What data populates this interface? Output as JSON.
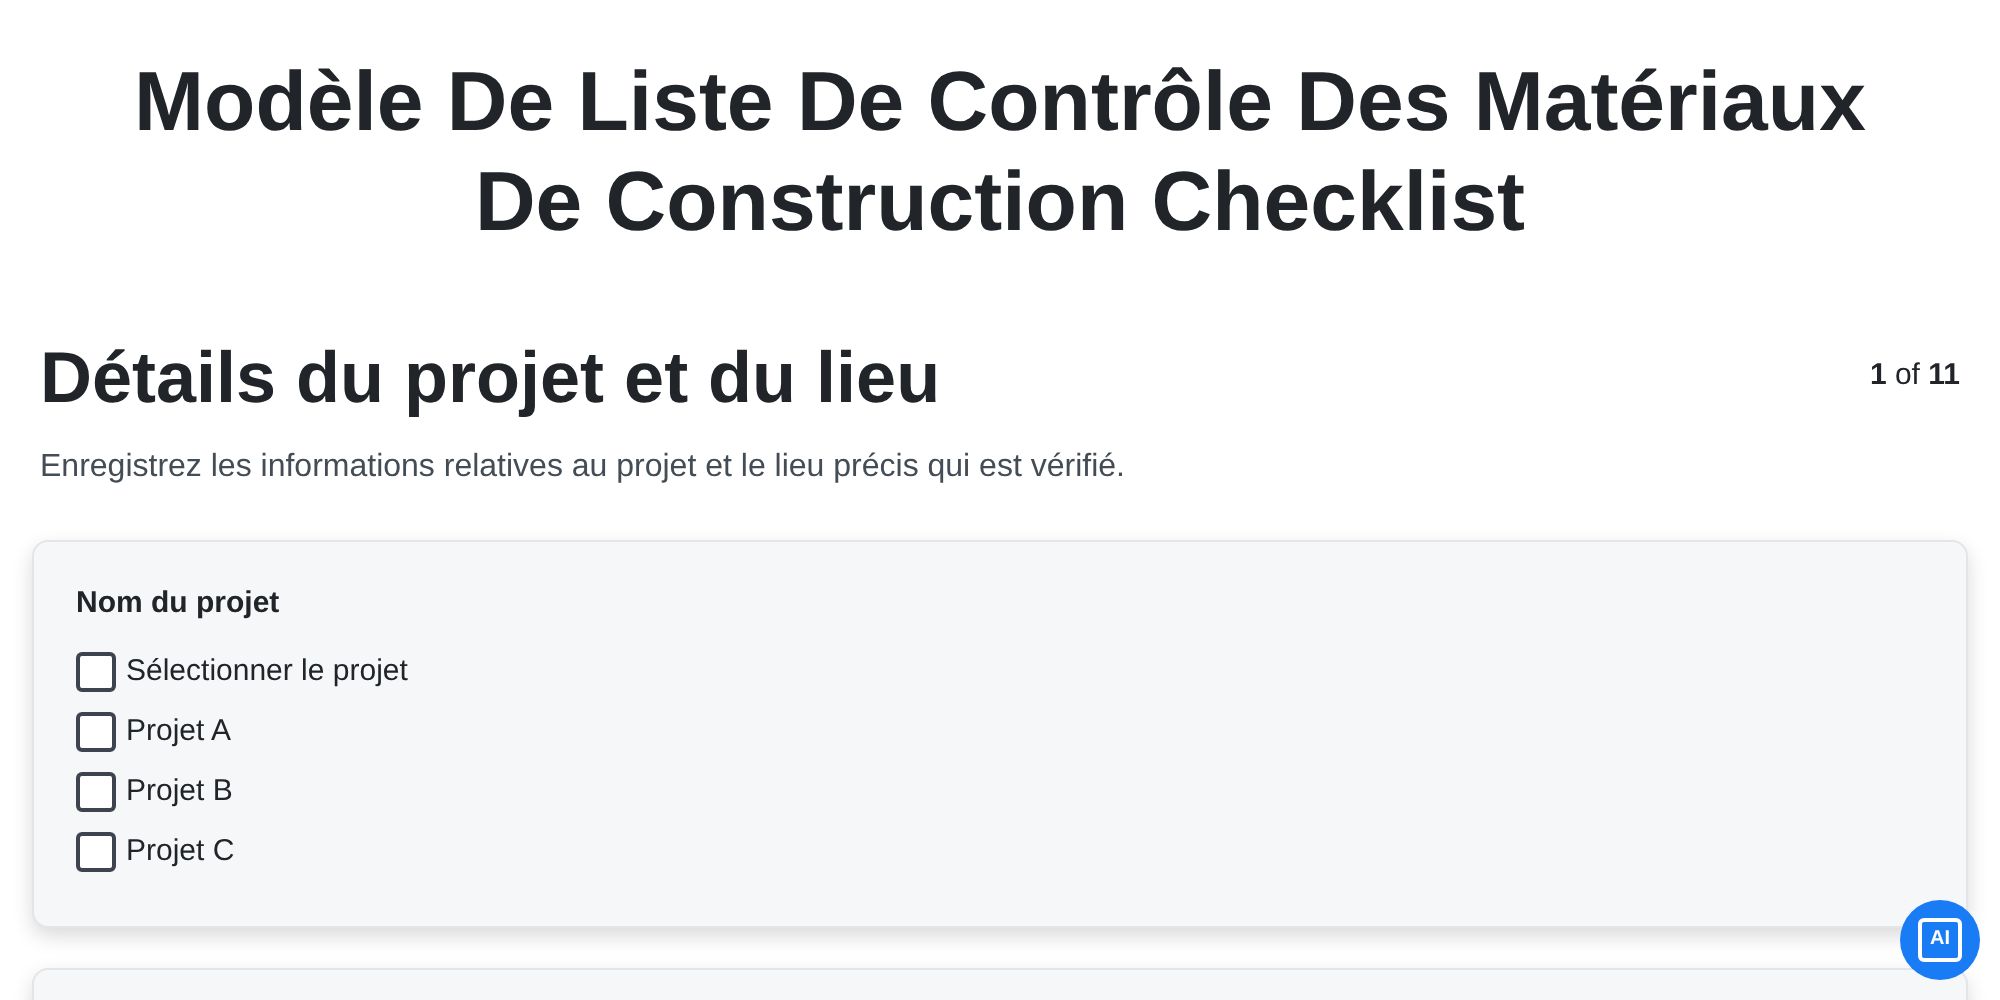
{
  "title": "Modèle De Liste De Contrôle Des Matériaux De Construction Checklist",
  "section": {
    "heading": "Détails du projet et du lieu",
    "counter": "**1** of **11**",
    "description": "Enregistrez les informations relatives au projet et le lieu précis qui est vérifié."
  },
  "fields": [
    {
      "label": "Nom du projet",
      "options": [
        {
          "label": "Sélectionner le projet",
          "checked": false
        },
        {
          "label": "Projet A",
          "checked": false
        },
        {
          "label": "Projet B",
          "checked": false
        },
        {
          "label": "Projet C",
          "checked": false
        }
      ]
    }
  ],
  "ai_button": {
    "label": "AI"
  }
}
